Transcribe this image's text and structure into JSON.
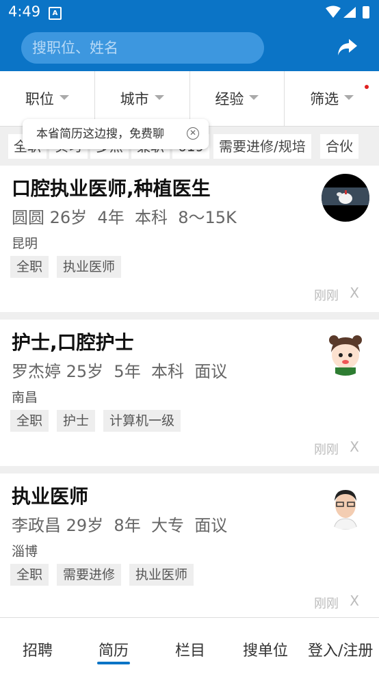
{
  "status_bar": {
    "time": "4:49",
    "app_icon": "A"
  },
  "header": {
    "search_placeholder": "搜职位、姓名",
    "share_icon": "share-icon"
  },
  "filters": [
    "职位",
    "城市",
    "经验",
    "筛选"
  ],
  "quick_tags": [
    "全职",
    "实习",
    "多点",
    "兼职",
    "619",
    "需要进修/规培",
    "合伙"
  ],
  "tooltip": {
    "text": "本省简历这边搜，免费聊"
  },
  "cards": [
    {
      "title": "口腔执业医师,种植医生",
      "info": "圆圆 26岁  4年  本科  8～15K",
      "city": "昆明",
      "tags": [
        "全职",
        "执业医师"
      ],
      "time": "刚刚",
      "close": "X"
    },
    {
      "title": "护士,口腔护士",
      "info": "罗杰婷 25岁  5年  本科  面议",
      "city": "南昌",
      "tags": [
        "全职",
        "护士",
        "计算机一级"
      ],
      "time": "刚刚",
      "close": "X"
    },
    {
      "title": "执业医师",
      "info": "李政昌 29岁  8年  大专  面议",
      "city": "淄博",
      "tags": [
        "全职",
        "需要进修",
        "执业医师"
      ],
      "time": "刚刚",
      "close": "X"
    }
  ],
  "tabs": [
    "招聘",
    "简历",
    "栏目",
    "搜单位",
    "登入/注册"
  ],
  "active_tab": "简历",
  "colors": {
    "primary": "#0b74c6",
    "search_bg": "#3d97df",
    "accent_red": "#e02020"
  }
}
